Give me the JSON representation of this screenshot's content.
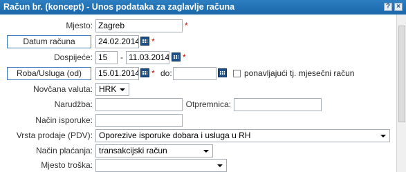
{
  "window": {
    "title": "Račun br. (koncept) - Unos podataka za zaglavlje računa",
    "help_label": "?",
    "close_label": "×"
  },
  "form": {
    "mjesto": {
      "label": "Mjesto:",
      "value": "Zagreb"
    },
    "datum_racuna": {
      "label": "Datum računa",
      "value": "24.02.2014"
    },
    "dospijece": {
      "label": "Dospijeće:",
      "days": "15",
      "separator": "-",
      "date": "11.03.2014"
    },
    "roba_usluga": {
      "label": "Roba/Usluga (od)",
      "from": "15.01.2014",
      "to_label": "do:",
      "to": "",
      "checkbox_label": "ponavljajući tj. mjesečni račun"
    },
    "valuta": {
      "label": "Novčana valuta:",
      "value": "HRK"
    },
    "narudzba": {
      "label": "Narudžba:",
      "value": ""
    },
    "otpremnica": {
      "label": "Otpremnica:",
      "value": ""
    },
    "nacin_isporuke": {
      "label": "Način isporuke:",
      "value": ""
    },
    "vrsta_prodaje": {
      "label": "Vrsta prodaje (PDV):",
      "value": "Oporezive isporuke dobara i usluga u RH"
    },
    "nacin_placanja": {
      "label": "Način plaćanja:",
      "value": "transakcijski račun"
    },
    "mjesto_troska": {
      "label": "Mjesto troška:",
      "value": ""
    },
    "required_marker": "*"
  },
  "colors": {
    "title_bar": "#1c6fb4",
    "required": "#d00000",
    "label_border": "#3b7dc0"
  }
}
